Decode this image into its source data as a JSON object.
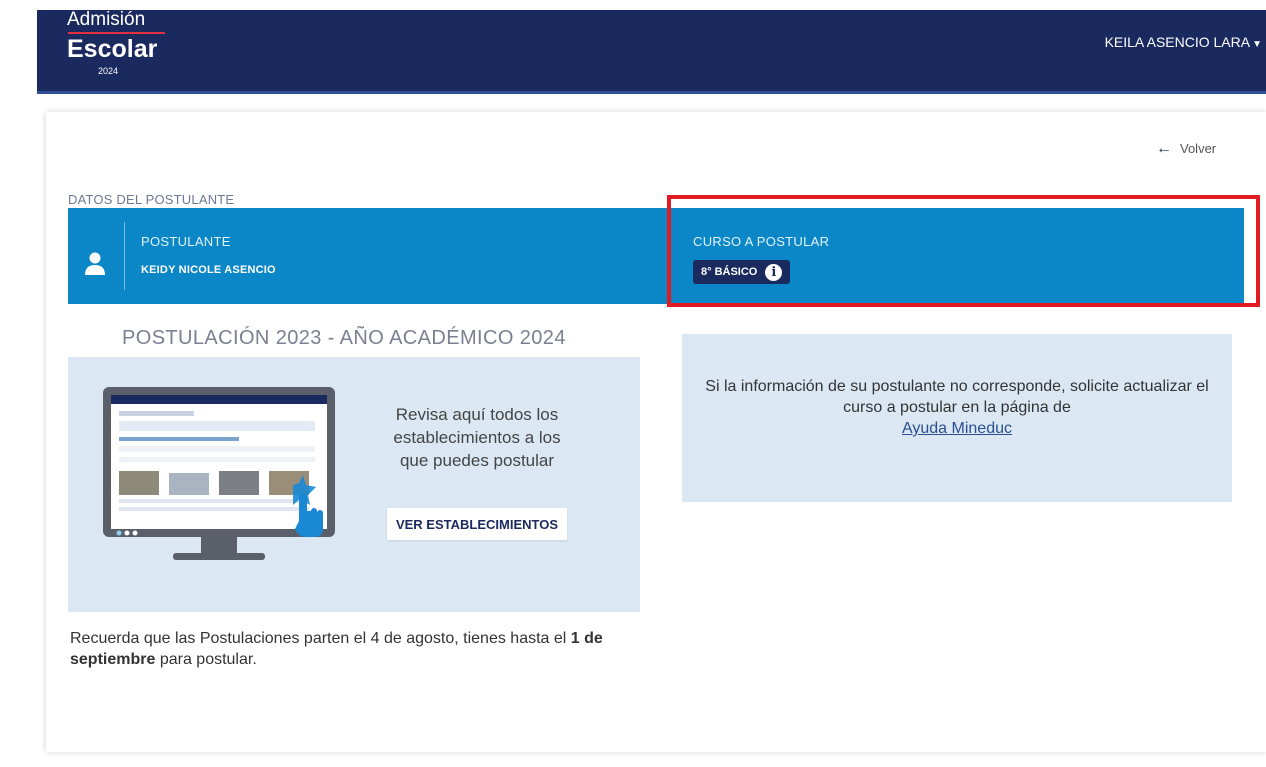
{
  "header": {
    "logo_line1": "Admisión",
    "logo_line2": "Escolar",
    "logo_year": "2024",
    "user_name": "KEILA ASENCIO LARA",
    "colors": {
      "navy": "#1b2a5e",
      "logo_red": "#e2303e"
    }
  },
  "nav": {
    "back_label": "Volver",
    "back_icon": "arrow-left-icon"
  },
  "applicant": {
    "section_label": "DATOS DEL POSTULANTE",
    "postulante_label": "POSTULANTE",
    "postulante_name": "KEIDY NICOLE ASENCIO",
    "curso_label": "CURSO A POSTULAR",
    "curso_value": "8° BÁSICO",
    "icons": [
      "user-icon",
      "info-icon"
    ],
    "band_color": "#0b87c8",
    "highlight_color": "#e21b23"
  },
  "postulacion": {
    "title": "POSTULACIÓN 2023 - AÑO ACADÉMICO 2024",
    "promo_text": "Revisa aquí todos los establecimientos a los que puedes postular",
    "button_label": "VER ESTABLECIMIENTOS",
    "reminder_part1": "Recuerda que las Postulaciones parten el 4 de agosto, tienes hasta el ",
    "reminder_bold": "1 de septiembre",
    "reminder_part2": " para postular."
  },
  "info": {
    "text": "Si la información de su postulante no corresponde, solicite actualizar el curso a postular en la página de",
    "link_label": "Ayuda Mineduc"
  }
}
